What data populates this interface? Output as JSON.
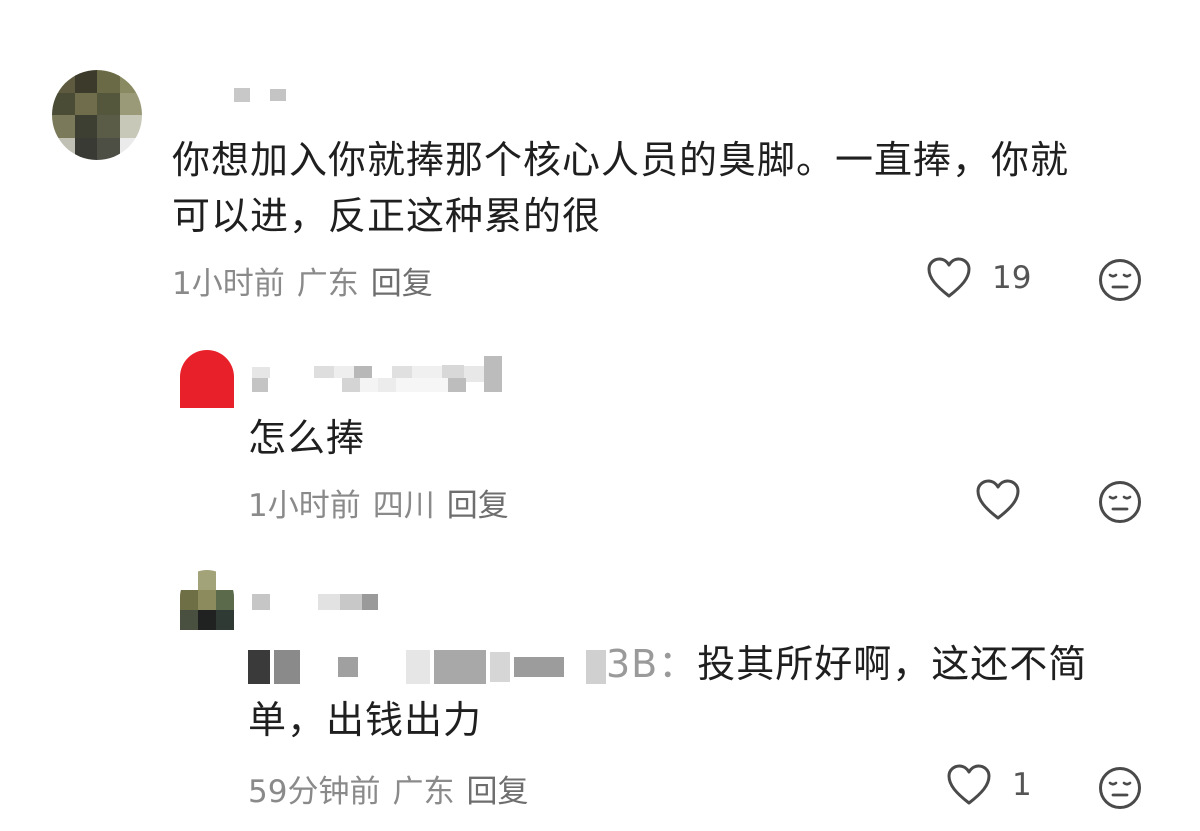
{
  "comments": [
    {
      "level": "top",
      "text": "你想加入你就捧那个核心人员的臭脚。一直捧，你就可以进，反正这种累的很",
      "text_line1": "你想加入你就捧那个核心人员的臭脚。一直捧，你就",
      "text_line2": "可以进，反正这种累的很",
      "time": "1小时前",
      "location": "广东",
      "reply_label": "回复",
      "like_count": "19",
      "like_icon": "heart-outline-icon",
      "dislike_icon": "neutral-face-icon"
    },
    {
      "level": "reply",
      "text": "怎么捧",
      "time": "1小时前",
      "location": "四川",
      "reply_label": "回复",
      "like_count": "",
      "like_icon": "heart-outline-icon",
      "dislike_icon": "neutral-face-icon"
    },
    {
      "level": "reply",
      "mention_suffix": "3B：",
      "text_line1_rest": "投其所好啊，这还不简",
      "text_line2": "单，出钱出力",
      "time": "59分钟前",
      "location": "广东",
      "reply_label": "回复",
      "like_count": "1",
      "like_icon": "heart-outline-icon",
      "dislike_icon": "neutral-face-icon"
    }
  ],
  "colors": {
    "text": "#1f1f1f",
    "meta": "#8a8a8a",
    "icon": "#4a4a4a",
    "avatar_red": "#e8202a"
  }
}
